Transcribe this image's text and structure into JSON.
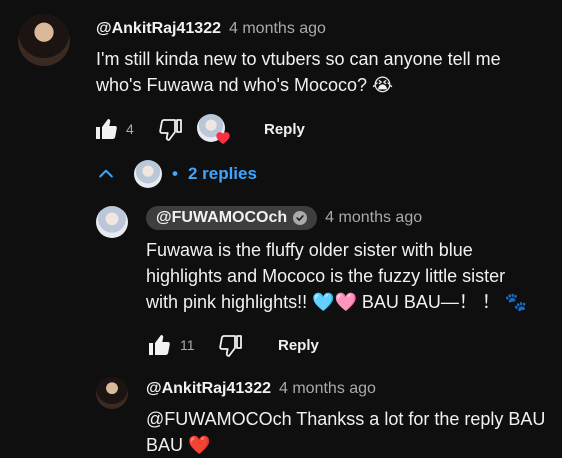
{
  "comment": {
    "author": "@AnkitRaj41322",
    "time": "4 months ago",
    "text_line1": "I'm still kinda new to vtubers so can anyone tell me",
    "text_line2": "who's Fuwawa nd who's Mococo? 😭",
    "likes": "4",
    "reply_label": "Reply",
    "replies_label": "2 replies"
  },
  "replies": [
    {
      "author": "@FUWAMOCOch",
      "time": "4 months ago",
      "text_line1": "Fuwawa is the fluffy older sister with blue",
      "text_line2": "highlights and Mococo is the fuzzy little sister",
      "text_line3": "with pink highlights!! 🩵🩷 BAU BAU—！ ！ 🐾",
      "likes": "11",
      "reply_label": "Reply"
    },
    {
      "author": "@AnkitRaj41322",
      "time": "4 months ago",
      "text_line1": "@FUWAMOCOch  Thankss a lot for the reply BAU",
      "text_line2": "BAU ❤️"
    }
  ],
  "colors": {
    "background": "#0f0f0f",
    "link_blue": "#3ea6ff",
    "heart_red": "#ff2f45",
    "muted": "#aaaaaa"
  },
  "icons": [
    "like-icon",
    "dislike-icon",
    "heart-icon",
    "chevron-up-icon",
    "verified-check-icon"
  ]
}
